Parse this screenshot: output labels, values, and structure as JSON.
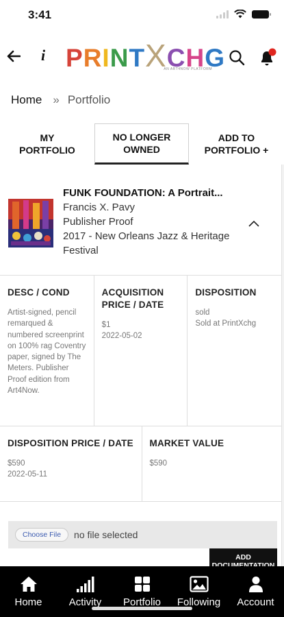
{
  "status_bar": {
    "time": "3:41"
  },
  "header": {
    "logo": {
      "text": "PRINTXCHG",
      "letters": [
        "P",
        "R",
        "I",
        "N",
        "T",
        "X",
        "C",
        "H",
        "G"
      ],
      "tagline": "AN ART4NOW PLATFORM"
    },
    "info_label": "i"
  },
  "breadcrumb": {
    "home": "Home",
    "separator": "»",
    "current": "Portfolio"
  },
  "tabs": [
    {
      "label": "MY PORTFOLIO",
      "active": false
    },
    {
      "label": "NO LONGER OWNED",
      "active": true
    },
    {
      "label": "ADD TO PORTFOLIO +",
      "active": false
    }
  ],
  "item": {
    "title": "FUNK FOUNDATION: A Portrait...",
    "artist": "Francis X. Pavy",
    "edition": "Publisher Proof",
    "event": "2017 - New Orleans Jazz & Heritage Festival"
  },
  "details": {
    "desc_cond": {
      "label": "DESC / COND",
      "value": "Artist-signed, pencil remarqued & numbered screenprint on 100% rag Coventry paper, signed by The Meters. Publisher Proof edition from Art4Now."
    },
    "acquisition": {
      "label": "ACQUISITION PRICE / DATE",
      "price": "$1",
      "date": "2022-05-02"
    },
    "disposition": {
      "label": "DISPOSITION",
      "status": "sold",
      "detail": "Sold at PrintXchg"
    },
    "disposition_price": {
      "label": "DISPOSITION PRICE / DATE",
      "price": "$590",
      "date": "2022-05-11"
    },
    "market_value": {
      "label": "MARKET VALUE",
      "value": "$590"
    }
  },
  "upload": {
    "choose_label": "Choose File",
    "status": "no file selected",
    "add_doc_label": "ADD DOCUMENTATION"
  },
  "bottom_nav": [
    {
      "label": "Home",
      "icon": "home-icon"
    },
    {
      "label": "Activity",
      "icon": "activity-icon"
    },
    {
      "label": "Portfolio",
      "icon": "portfolio-icon"
    },
    {
      "label": "Following",
      "icon": "image-icon"
    },
    {
      "label": "Account",
      "icon": "account-icon"
    }
  ],
  "colors": {
    "logo_letters": [
      "#d6443a",
      "#e87d2b",
      "#efb81f",
      "#3b9b4a",
      "#2f79c4",
      "#b9a37a",
      "#8b4fb0",
      "#d6448a",
      "#2f79c4"
    ],
    "notification_dot": "#e0261f",
    "nav_background": "#000000",
    "add_doc_background": "#111111"
  }
}
